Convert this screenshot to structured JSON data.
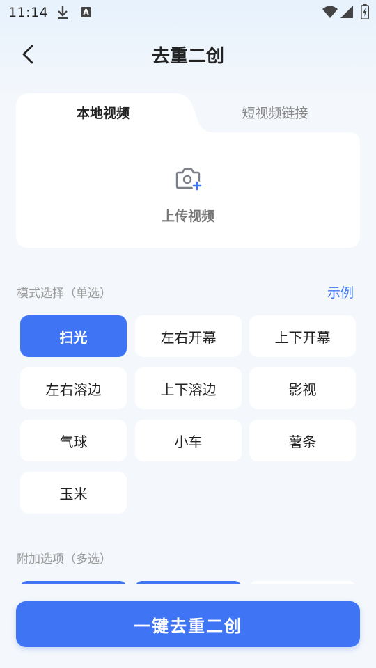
{
  "status_bar": {
    "time": "11:14"
  },
  "nav": {
    "title": "去重二创"
  },
  "tabs": [
    {
      "label": "本地视频",
      "active": true
    },
    {
      "label": "短视频链接",
      "active": false
    }
  ],
  "upload": {
    "label": "上传视频",
    "icon": "camera-add-icon"
  },
  "mode": {
    "label": "模式选择（单选）",
    "example_link": "示例",
    "options": [
      {
        "label": "扫光",
        "selected": true
      },
      {
        "label": "左右开幕",
        "selected": false
      },
      {
        "label": "上下开幕",
        "selected": false
      },
      {
        "label": "左右溶边",
        "selected": false
      },
      {
        "label": "上下溶边",
        "selected": false
      },
      {
        "label": "影视",
        "selected": false
      },
      {
        "label": "气球",
        "selected": false
      },
      {
        "label": "小车",
        "selected": false
      },
      {
        "label": "薯条",
        "selected": false
      },
      {
        "label": "玉米",
        "selected": false
      }
    ]
  },
  "extras": {
    "label": "附加选项（多选）"
  },
  "cta": {
    "label": "一键去重二创"
  },
  "colors": {
    "accent": "#3f75f5",
    "background": "#f4f7fb",
    "card": "#ffffff"
  }
}
